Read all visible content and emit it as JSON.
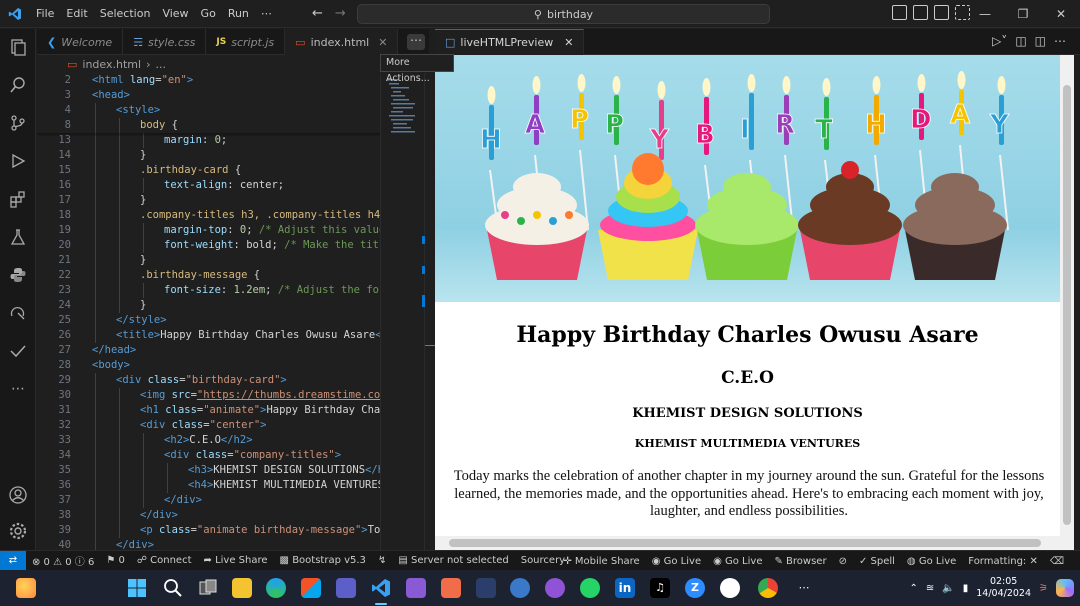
{
  "titlebar": {
    "menu": [
      "File",
      "Edit",
      "Selection",
      "View",
      "Go",
      "Run",
      "⋯"
    ],
    "search": "birthday"
  },
  "tabs": [
    {
      "label": "Welcome",
      "icon": "vscode-logo-icon"
    },
    {
      "label": "style.css",
      "icon": "css-file-icon"
    },
    {
      "label": "script.js",
      "icon": "js-file-icon"
    },
    {
      "label": "index.html",
      "icon": "html-file-icon"
    }
  ],
  "tooltip": "More Actions...",
  "preview_tab": "liveHTMLPreview",
  "breadcrumb": {
    "file": "index.html",
    "rest": "..."
  },
  "code": [
    {
      "n": "2",
      "html": "<span class='tag'>&lt;html</span> <span class='attr'>lang</span><span class='txt'>=</span><span class='str'>\"en\"</span><span class='tag'>&gt;</span>",
      "indent": 0
    },
    {
      "n": "3",
      "html": "<span class='tag'>&lt;head&gt;</span>",
      "indent": 0
    },
    {
      "n": "4",
      "html": "<span class='tag'>&lt;style&gt;</span>",
      "indent": 1
    },
    {
      "n": "8",
      "html": "<span class='sel'>body</span> <span class='txt'>{</span>",
      "indent": 2
    },
    {
      "n": "13",
      "html": "<span class='prop'>margin</span><span class='txt'>: </span><span class='num'>0</span><span class='txt'>;</span>",
      "indent": 3
    },
    {
      "n": "14",
      "html": "<span class='txt'>}</span>",
      "indent": 2
    },
    {
      "n": "15",
      "html": "<span class='sel'>.birthday-card</span> <span class='txt'>{</span>",
      "indent": 2
    },
    {
      "n": "16",
      "html": "<span class='prop'>text-align</span><span class='txt'>: center;</span>",
      "indent": 3
    },
    {
      "n": "17",
      "html": "<span class='txt'>}</span>",
      "indent": 2
    },
    {
      "n": "18",
      "html": "<span class='sel'>.company-titles h3, .company-titles h4</span> <span class='txt'>-</span>",
      "indent": 2
    },
    {
      "n": "19",
      "html": "<span class='prop'>margin-top</span><span class='txt'>: </span><span class='num'>0</span><span class='txt'>; </span><span class='cmt'>/* Adjust this value</span>",
      "indent": 3
    },
    {
      "n": "20",
      "html": "<span class='prop'>font-weight</span><span class='txt'>: bold; </span><span class='cmt'>/* Make the title</span>",
      "indent": 3
    },
    {
      "n": "21",
      "html": "<span class='txt'>}</span>",
      "indent": 2
    },
    {
      "n": "22",
      "html": "<span class='sel'>.birthday-message</span> <span class='txt'>{</span>",
      "indent": 2
    },
    {
      "n": "23",
      "html": "<span class='prop'>font-size</span><span class='txt'>: </span><span class='num'>1.2em</span><span class='txt'>; </span><span class='cmt'>/* Adjust the font</span>",
      "indent": 3
    },
    {
      "n": "24",
      "html": "<span class='txt'>}</span>",
      "indent": 2
    },
    {
      "n": "25",
      "html": "<span class='tag'>&lt;/style&gt;</span>",
      "indent": 1
    },
    {
      "n": "26",
      "html": "<span class='tag'>&lt;title&gt;</span><span class='txt'>Happy Birthday Charles Owusu Asare</span><span class='tag'>&lt;/</span>",
      "indent": 1
    },
    {
      "n": "27",
      "html": "<span class='tag'>&lt;/head&gt;</span>",
      "indent": 0
    },
    {
      "n": "28",
      "html": "<span class='tag'>&lt;body&gt;</span>",
      "indent": 0
    },
    {
      "n": "29",
      "html": "<span class='tag'>&lt;div</span> <span class='attr'>class</span><span class='txt'>=</span><span class='str'>\"birthday-card\"</span><span class='tag'>&gt;</span>",
      "indent": 1
    },
    {
      "n": "30",
      "html": "<span class='tag'>&lt;img</span> <span class='attr'>src</span><span class='txt'>=</span><span class='link'>\"https://thumbs.dreamstime.com</span>",
      "indent": 2
    },
    {
      "n": "31",
      "html": "<span class='tag'>&lt;h1</span> <span class='attr'>class</span><span class='txt'>=</span><span class='str'>\"animate\"</span><span class='tag'>&gt;</span><span class='txt'>Happy Birthday Char</span>",
      "indent": 2
    },
    {
      "n": "32",
      "html": "<span class='tag'>&lt;div</span> <span class='attr'>class</span><span class='txt'>=</span><span class='str'>\"center\"</span><span class='tag'>&gt;</span>",
      "indent": 2
    },
    {
      "n": "33",
      "html": "<span class='tag'>&lt;h2&gt;</span><span class='txt'>C.E.O</span><span class='tag'>&lt;/h2&gt;</span>",
      "indent": 3
    },
    {
      "n": "34",
      "html": "<span class='tag'>&lt;div</span> <span class='attr'>class</span><span class='txt'>=</span><span class='str'>\"company-titles\"</span><span class='tag'>&gt;</span>",
      "indent": 3
    },
    {
      "n": "35",
      "html": "<span class='tag'>&lt;h3&gt;</span><span class='txt'>KHEMIST DESIGN SOLUTIONS</span><span class='tag'>&lt;/h</span>",
      "indent": 4
    },
    {
      "n": "36",
      "html": "<span class='tag'>&lt;h4&gt;</span><span class='txt'>KHEMIST MULTIMEDIA VENTURES</span>",
      "indent": 4
    },
    {
      "n": "37",
      "html": "<span class='tag'>&lt;/div&gt;</span>",
      "indent": 3
    },
    {
      "n": "38",
      "html": "<span class='tag'>&lt;/div&gt;</span>",
      "indent": 2
    },
    {
      "n": "39",
      "html": "<span class='tag'>&lt;p</span> <span class='attr'>class</span><span class='txt'>=</span><span class='str'>\"animate birthday-message\"</span><span class='tag'>&gt;</span><span class='txt'>Toda</span>",
      "indent": 2
    },
    {
      "n": "40",
      "html": "<span class='tag'>&lt;/div&gt;</span>",
      "indent": 1
    }
  ],
  "preview": {
    "hero_letters": [
      "H",
      "A",
      "P",
      "P",
      "Y",
      "B",
      "I",
      "R",
      "T",
      "H",
      "D",
      "A",
      "Y"
    ],
    "letter_colors": [
      "#2a9fd6",
      "#8e3fc4",
      "#f5c400",
      "#2bb34b",
      "#e63e8a",
      "#e5197b",
      "#2a9fd6",
      "#9a3fb8",
      "#2bb34b",
      "#f2a900",
      "#e5197b",
      "#f5c400",
      "#2a9fd6"
    ],
    "watermark": "dreamstime",
    "h1": "Happy Birthday Charles Owusu Asare",
    "h2": "C.E.O",
    "h3": "KHEMIST DESIGN SOLUTIONS",
    "h4": "KHEMIST MULTIMEDIA VENTURES",
    "message": "Today marks the celebration of another chapter in my journey around the sun. Grateful for the lessons learned, the memories made, and the opportunities ahead. Here's to embracing each moment with joy, laughter, and endless possibilities."
  },
  "statusbar": {
    "problems": "⊗ 0 ⚠ 0 ⓘ 6",
    "ports": "⚑ 0",
    "connect": "Connect",
    "liveshare": "Live Share",
    "bootstrap": "Bootstrap v5.3",
    "server": "Server not selected",
    "sourcery": "Sourcery",
    "mobile": "Mobile Share",
    "golive1": "Go Live",
    "golive2": "Go Live",
    "browser": "Browser",
    "spell": "Spell",
    "golive3": "Go Live",
    "formatting": "Formatting: ✕"
  },
  "taskbar": {
    "time": "02:05",
    "date": "14/04/2024",
    "apps": [
      "weather",
      "windows",
      "search",
      "task-view",
      "file-explorer",
      "edge",
      "store",
      "teams",
      "vscode",
      "visual-studio",
      "git",
      "pycharm",
      "drive",
      "github-desktop",
      "whatsapp",
      "linkedin",
      "tiktok",
      "zoom",
      "github",
      "chrome",
      "more"
    ]
  },
  "colors": {
    "accent": "#0078d4",
    "editor_bg": "#1f1f1f"
  }
}
